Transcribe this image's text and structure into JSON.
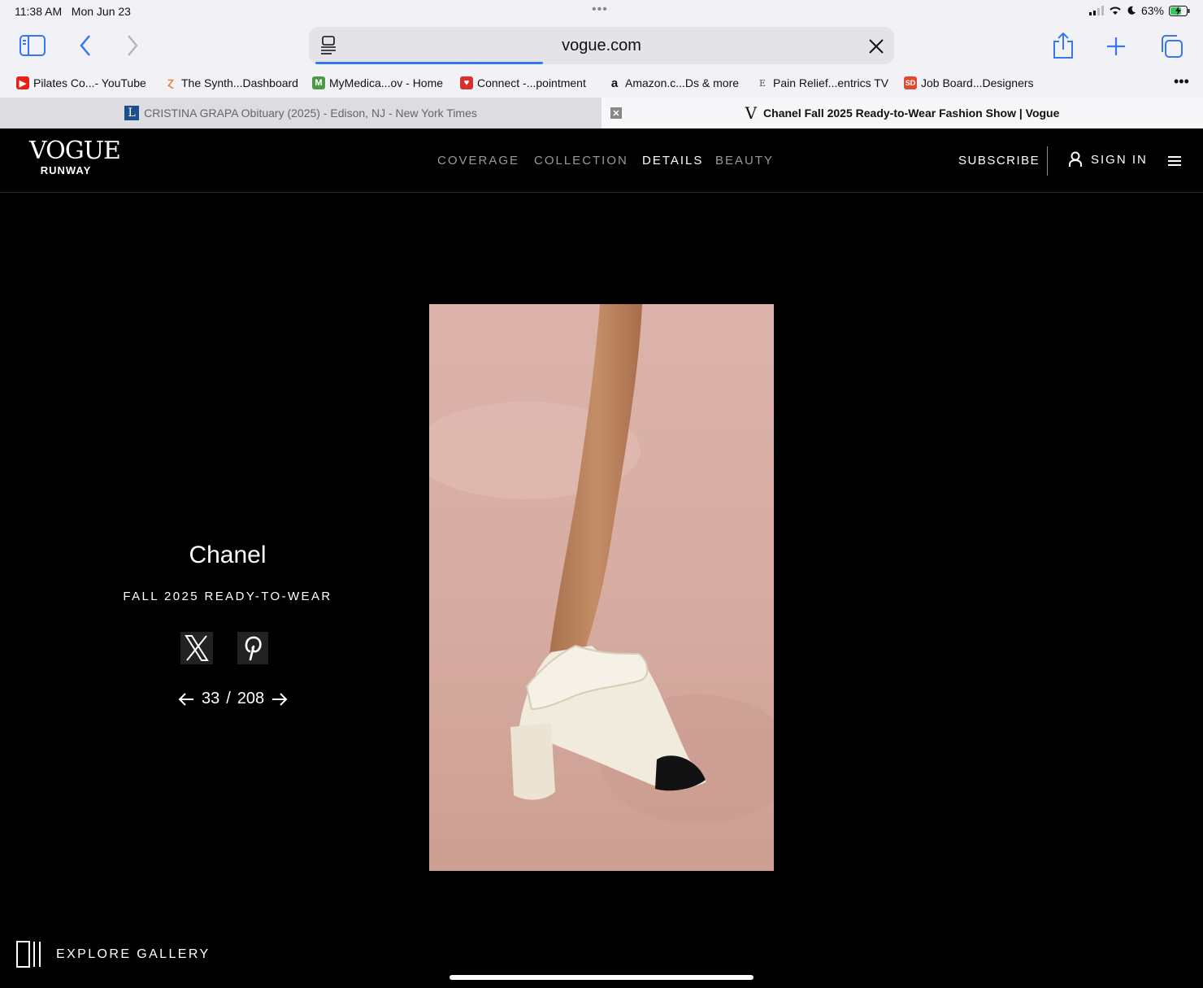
{
  "status": {
    "time": "11:38 AM",
    "date": "Mon Jun 23",
    "battery": "63%"
  },
  "address_bar": {
    "url": "vogue.com"
  },
  "bookmarks": [
    {
      "label": "Pilates Co...- YouTube",
      "icon": "youtube-icon",
      "color": "#e62117"
    },
    {
      "label": "The Synth...Dashboard",
      "icon": "synth-icon",
      "color": "#e07a3a"
    },
    {
      "label": "MyMedica...ov - Home",
      "icon": "mymedicare-icon",
      "color": "#4c9a48"
    },
    {
      "label": "Connect -...pointment",
      "icon": "connect-icon",
      "color": "#d63031"
    },
    {
      "label": "Amazon.c...Ds & more",
      "icon": "amazon-icon",
      "color": "#111111"
    },
    {
      "label": "Pain Relief...entrics TV",
      "icon": "pain-relief-icon",
      "color": "#555555"
    },
    {
      "label": "Job Board...Designers",
      "icon": "job-board-icon",
      "color": "#e04b2f"
    }
  ],
  "tabs": {
    "inactive": {
      "title": "CRISTINA GRAPA Obituary (2025) - Edison, NJ - New York Times",
      "favicon": "L"
    },
    "active": {
      "title": "Chanel Fall 2025 Ready-to-Wear Fashion Show | Vogue",
      "favicon": "V"
    }
  },
  "vogue_nav": {
    "logo": "VOGUE",
    "logo_sub": "RUNWAY",
    "links": [
      "COVERAGE",
      "COLLECTION",
      "DETAILS",
      "BEAUTY"
    ],
    "active_link": "DETAILS",
    "subscribe": "SUBSCRIBE",
    "sign_in": "SIGN IN"
  },
  "show": {
    "designer": "Chanel",
    "season": "FALL 2025 READY-TO-WEAR",
    "current": "33",
    "separator": "/",
    "total": "208"
  },
  "explore": "EXPLORE GALLERY",
  "colors": {
    "accent_blue": "#3478f6",
    "page_bg": "#000000",
    "chrome_bg": "#f2f2f6"
  }
}
